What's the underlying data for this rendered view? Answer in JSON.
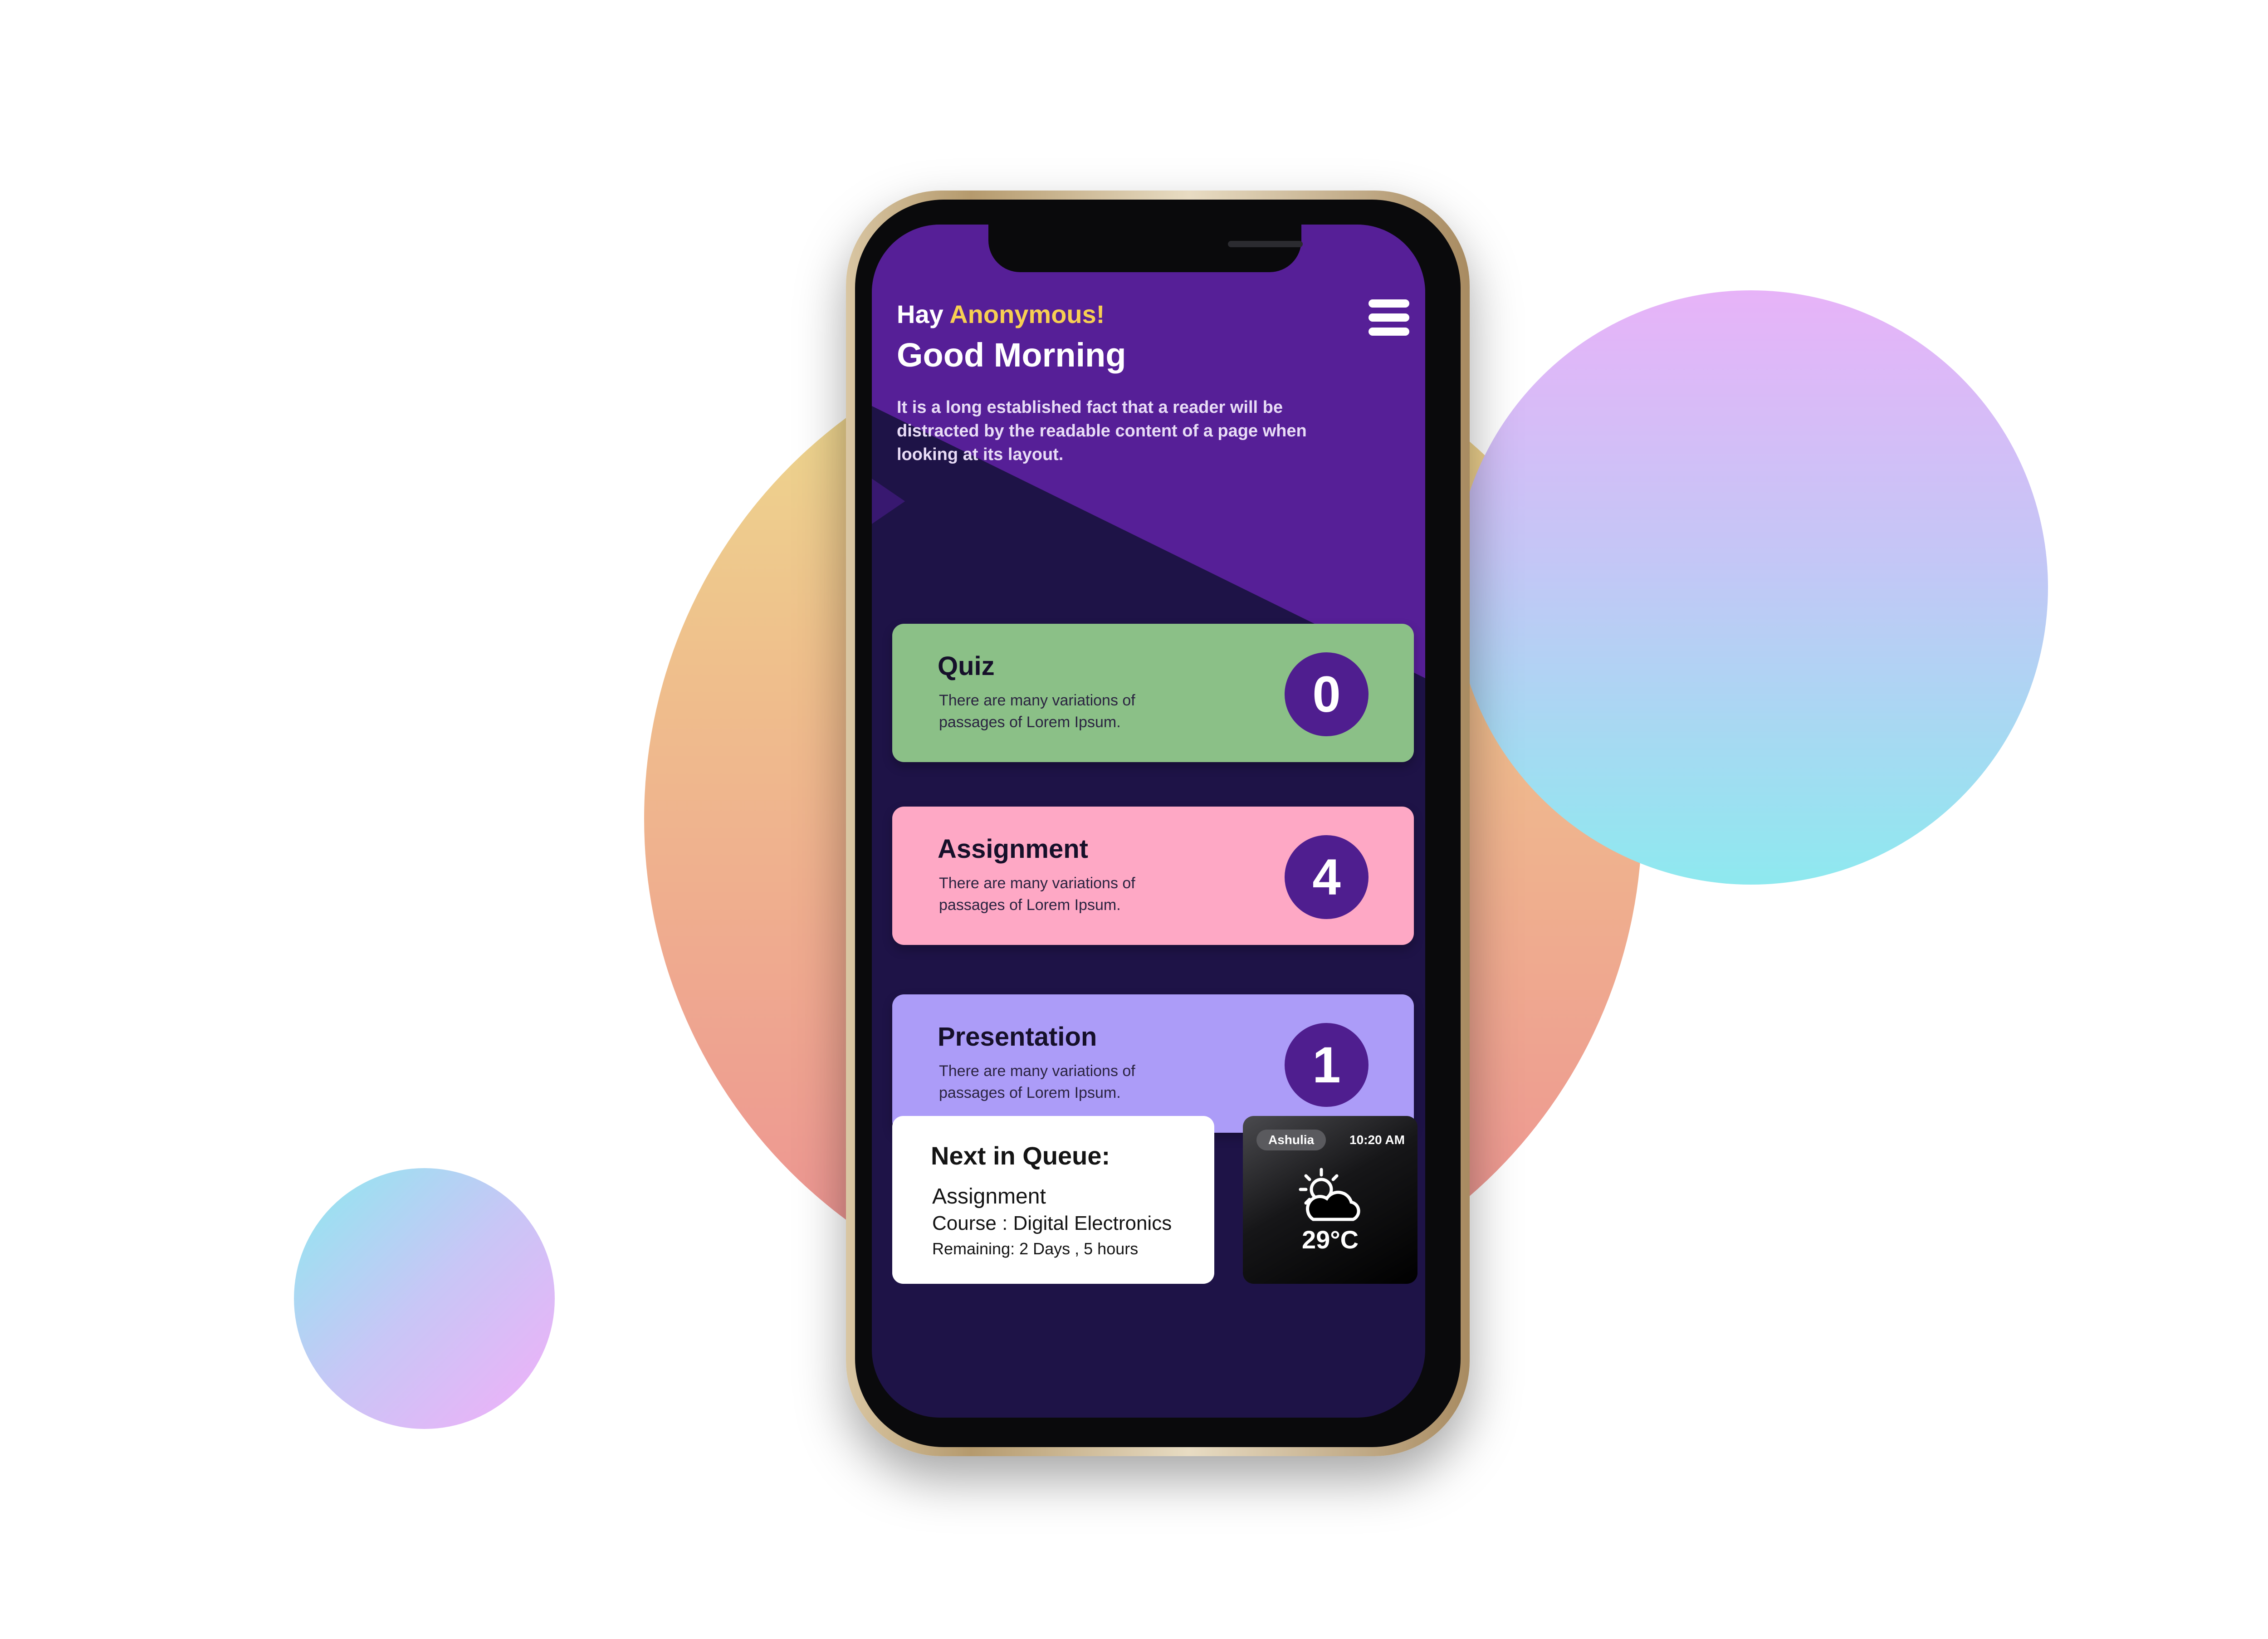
{
  "greeting": {
    "prefix": "Hay",
    "name": "Anonymous!",
    "title": "Good Morning"
  },
  "intro": "It is a long established fact that a reader will be distracted by the readable content of a page when looking at its layout.",
  "menu": {
    "icon": "hamburger-menu-icon"
  },
  "cards": [
    {
      "title": "Quiz",
      "description": "There are many variations of passages of Lorem Ipsum.",
      "count": "0",
      "color": "#8bc087"
    },
    {
      "title": "Assignment",
      "description": "There are many variations of passages of Lorem Ipsum.",
      "count": "4",
      "color": "#fea8c5"
    },
    {
      "title": "Presentation",
      "description": "There are many variations of passages of Lorem Ipsum.",
      "count": "1",
      "color": "#ac9cf8"
    }
  ],
  "queue": {
    "title": "Next in Queue:",
    "item": "Assignment",
    "course": "Course : Digital Electronics",
    "remaining": "Remaining: 2 Days , 5 hours"
  },
  "weather": {
    "location": "Ashulia",
    "time": "10:20 AM",
    "temperature": "29°C",
    "icon": "partly-cloudy-icon"
  },
  "colors": {
    "accent_purple": "#561f97",
    "screen_background": "#1e1347",
    "greeting_name": "#f7cf52",
    "count_badge": "#4f1e8f"
  }
}
